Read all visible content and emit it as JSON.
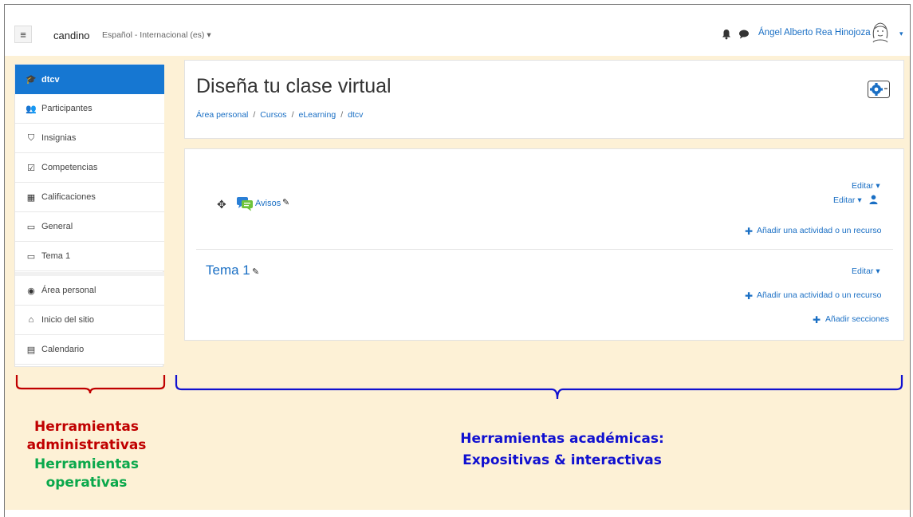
{
  "navbar": {
    "menu_icon": "hamburger-icon",
    "site_name": "candino",
    "language": "Español - Internacional (es) ▾",
    "user_name": "Ángel Alberto Rea Hinojoza",
    "user_caret": "▾"
  },
  "sidebar": {
    "items": [
      {
        "label": "dtcv",
        "icon": "graduation-cap-icon",
        "glyph": "🎓"
      },
      {
        "label": "Participantes",
        "icon": "users-icon",
        "glyph": "👥"
      },
      {
        "label": "Insignias",
        "icon": "shield-icon",
        "glyph": "⛉"
      },
      {
        "label": "Competencias",
        "icon": "checkbox-icon",
        "glyph": "☑"
      },
      {
        "label": "Calificaciones",
        "icon": "table-icon",
        "glyph": "▦"
      },
      {
        "label": "General",
        "icon": "folder-icon",
        "glyph": "▭"
      },
      {
        "label": "Tema 1",
        "icon": "folder-icon",
        "glyph": "▭"
      },
      {
        "label": "Área personal",
        "icon": "dashboard-icon",
        "glyph": "◉"
      },
      {
        "label": "Inicio del sitio",
        "icon": "home-icon",
        "glyph": "⌂"
      },
      {
        "label": "Calendario",
        "icon": "calendar-icon",
        "glyph": "▤"
      }
    ]
  },
  "header": {
    "title": "Diseña tu clase virtual",
    "breadcrumb": [
      "Área personal",
      "Cursos",
      "eLearning",
      "dtcv"
    ],
    "breadcrumb_sep": "/"
  },
  "course": {
    "section0": {
      "edit_label": "Editar ▾",
      "activity_name": "Avisos",
      "activity_edit_label": "Editar ▾",
      "add_activity_label": "Añadir una actividad o un recurso"
    },
    "section1": {
      "title": "Tema 1",
      "edit_label": "Editar ▾",
      "add_activity_label": "Añadir una actividad o un recurso",
      "add_sections_label": "Añadir secciones"
    },
    "plus_glyph": "✚",
    "pencil_glyph": "✎",
    "move_glyph": "✥"
  },
  "annotations": {
    "admin": [
      "Herramientas",
      "administrativas"
    ],
    "oper": [
      "Herramientas",
      "operativas"
    ],
    "acad": [
      "Herramientas académicas:",
      "Expositivas & interactivas"
    ],
    "colors": {
      "admin": "#c00000",
      "oper": "#0aa84b",
      "acad": "#1010d0"
    }
  }
}
